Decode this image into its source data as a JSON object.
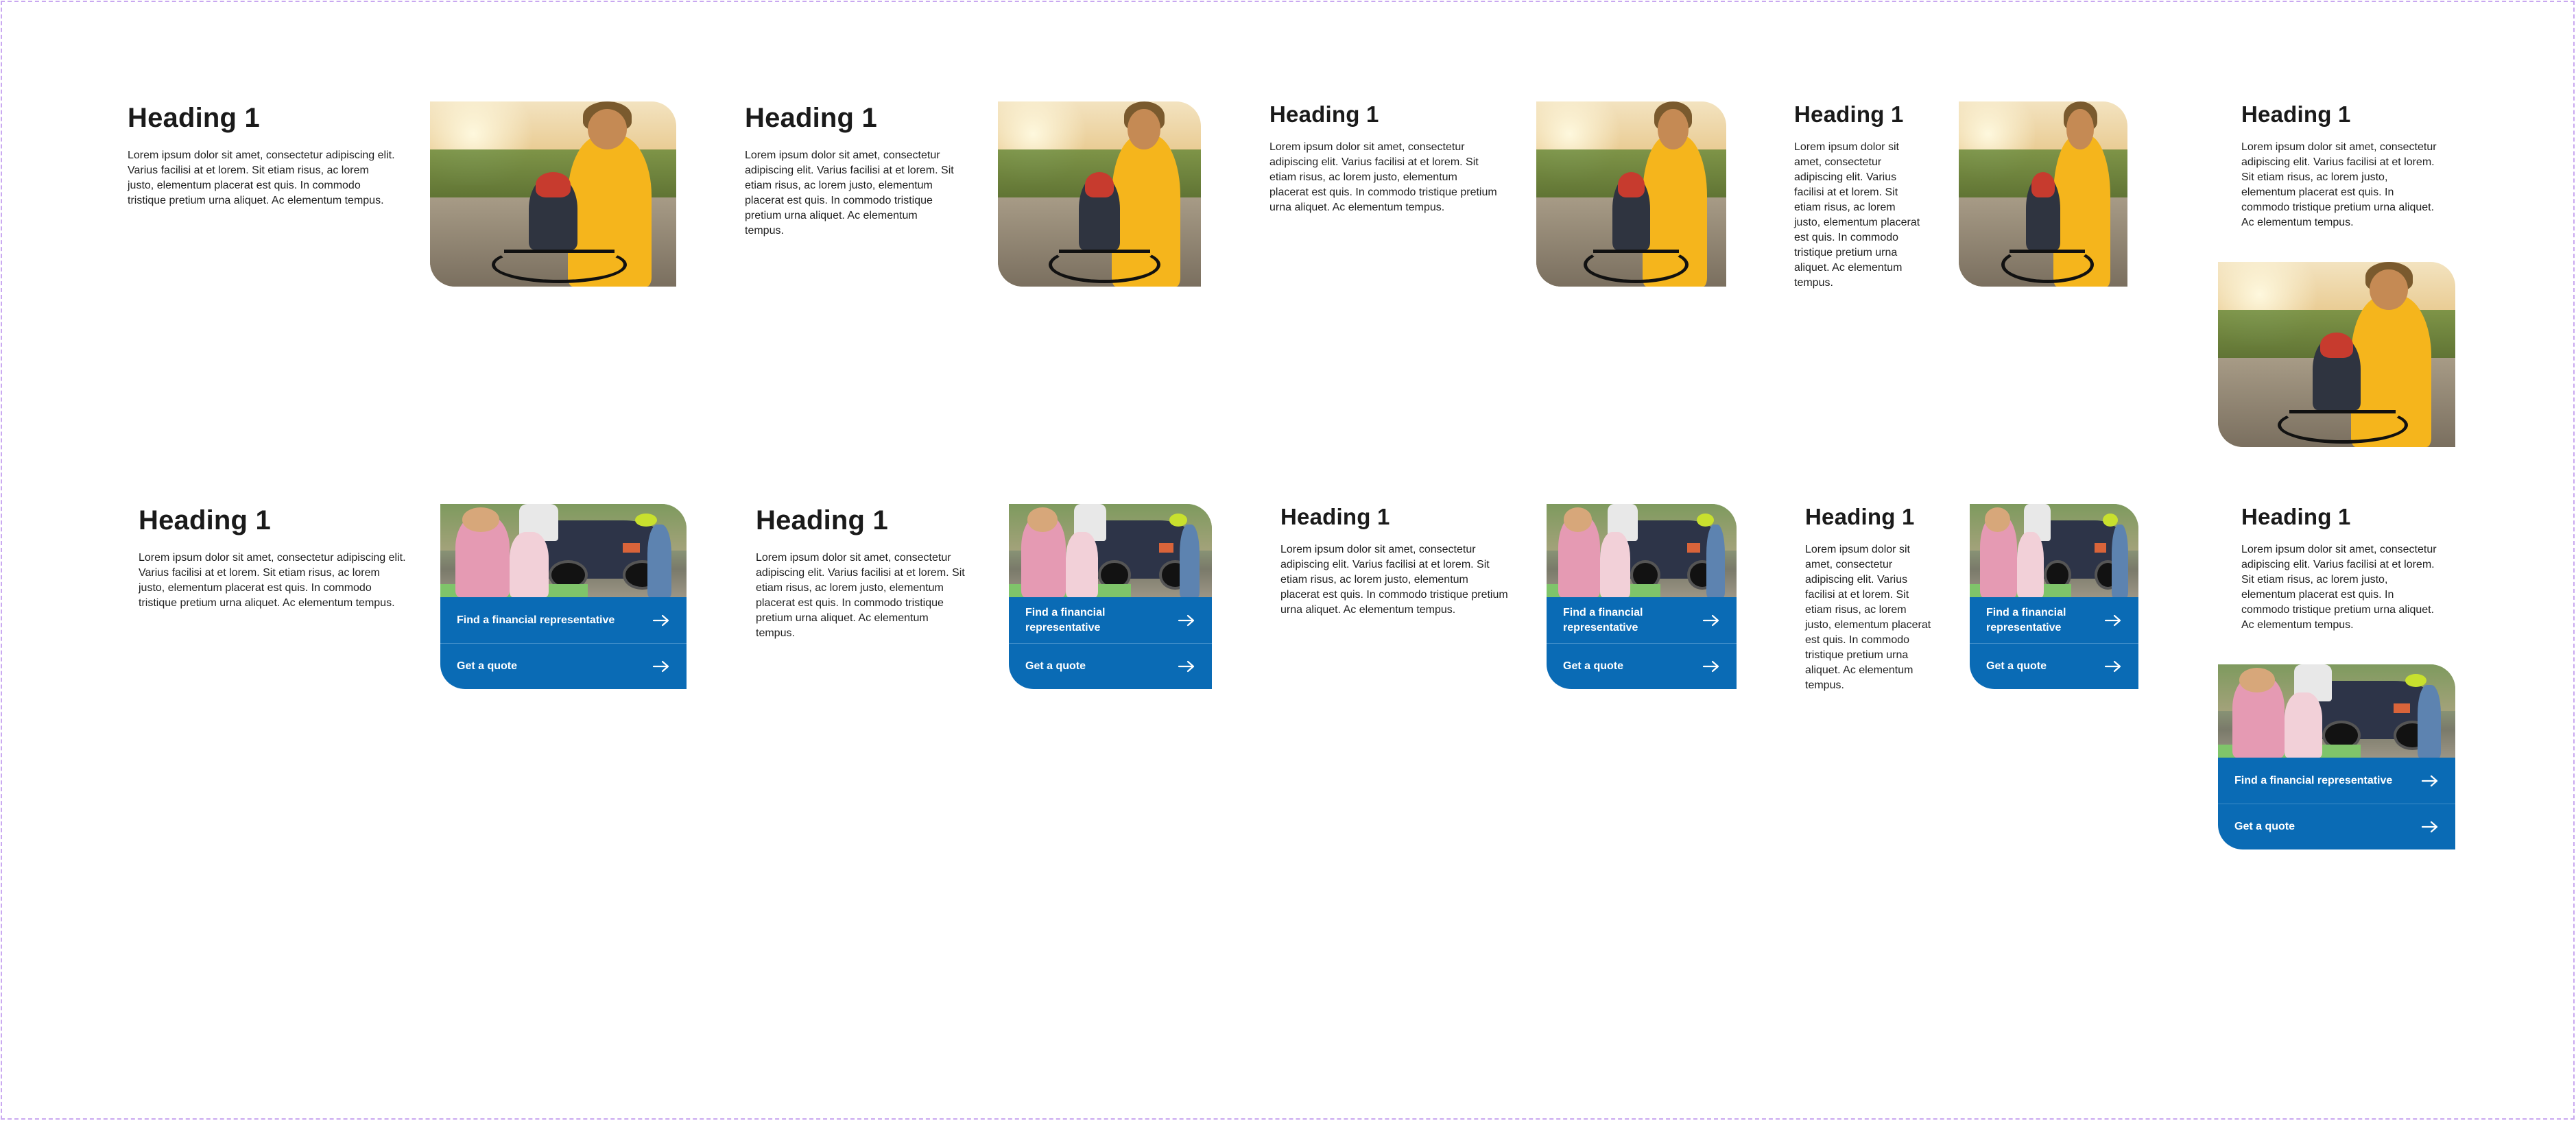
{
  "cards": {
    "heading": "Heading 1",
    "body": "Lorem ipsum dolor sit amet, consectetur adipiscing elit. Varius facilisi at et lorem. Sit etiam risus, ac lorem justo, elementum placerat est quis. In commodo tristique pretium urna aliquet. Ac elementum tempus."
  },
  "actions": {
    "find_rep": "Find a financial representative",
    "get_quote": "Get a quote"
  },
  "icons": {
    "arrow": "arrow-right-icon"
  },
  "colors": {
    "accent": "#0a6bb5",
    "frame_border": "#c9a8f0",
    "text": "#1a1a1a"
  }
}
